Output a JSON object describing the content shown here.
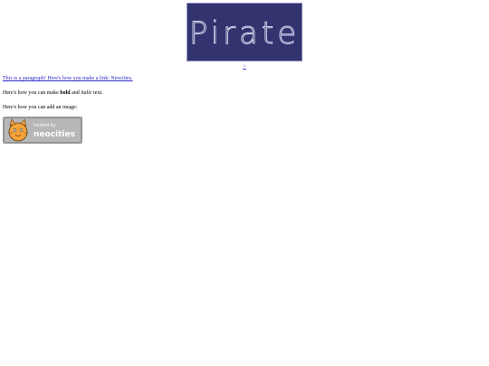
{
  "header": {
    "logo_text": "Pirate",
    "next_link": ">"
  },
  "content": {
    "paragraph1": "This is a paragraph! Here's how you make a link: Neocities.",
    "paragraph2_prefix": "Here's how you can make ",
    "paragraph2_bold": "bold",
    "paragraph2_middle": " and ",
    "paragraph2_italic": "italic",
    "paragraph2_suffix": " text.",
    "paragraph3": "Here's how you can add an image:"
  },
  "badge": {
    "text_top": "hosted by",
    "text_main": "neocities"
  },
  "colors": {
    "banner_bg": "#32336f",
    "banner_text": "#d9daf0",
    "link": "#2b27c9"
  }
}
